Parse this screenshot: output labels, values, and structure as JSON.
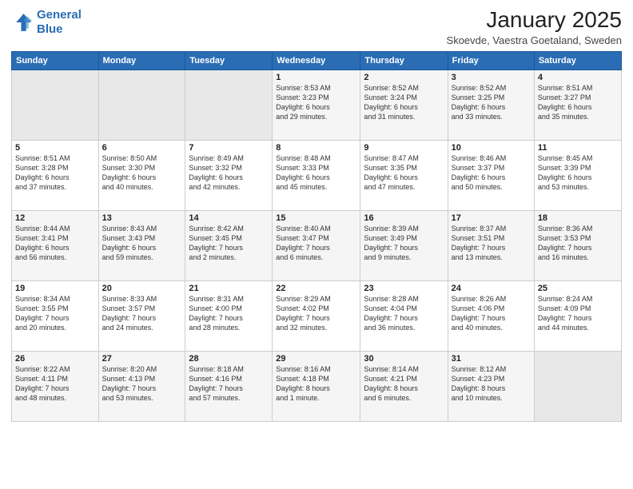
{
  "header": {
    "logo_line1": "General",
    "logo_line2": "Blue",
    "month": "January 2025",
    "location": "Skoevde, Vaestra Goetaland, Sweden"
  },
  "weekdays": [
    "Sunday",
    "Monday",
    "Tuesday",
    "Wednesday",
    "Thursday",
    "Friday",
    "Saturday"
  ],
  "weeks": [
    [
      {
        "day": "",
        "info": ""
      },
      {
        "day": "",
        "info": ""
      },
      {
        "day": "",
        "info": ""
      },
      {
        "day": "1",
        "info": "Sunrise: 8:53 AM\nSunset: 3:23 PM\nDaylight: 6 hours\nand 29 minutes."
      },
      {
        "day": "2",
        "info": "Sunrise: 8:52 AM\nSunset: 3:24 PM\nDaylight: 6 hours\nand 31 minutes."
      },
      {
        "day": "3",
        "info": "Sunrise: 8:52 AM\nSunset: 3:25 PM\nDaylight: 6 hours\nand 33 minutes."
      },
      {
        "day": "4",
        "info": "Sunrise: 8:51 AM\nSunset: 3:27 PM\nDaylight: 6 hours\nand 35 minutes."
      }
    ],
    [
      {
        "day": "5",
        "info": "Sunrise: 8:51 AM\nSunset: 3:28 PM\nDaylight: 6 hours\nand 37 minutes."
      },
      {
        "day": "6",
        "info": "Sunrise: 8:50 AM\nSunset: 3:30 PM\nDaylight: 6 hours\nand 40 minutes."
      },
      {
        "day": "7",
        "info": "Sunrise: 8:49 AM\nSunset: 3:32 PM\nDaylight: 6 hours\nand 42 minutes."
      },
      {
        "day": "8",
        "info": "Sunrise: 8:48 AM\nSunset: 3:33 PM\nDaylight: 6 hours\nand 45 minutes."
      },
      {
        "day": "9",
        "info": "Sunrise: 8:47 AM\nSunset: 3:35 PM\nDaylight: 6 hours\nand 47 minutes."
      },
      {
        "day": "10",
        "info": "Sunrise: 8:46 AM\nSunset: 3:37 PM\nDaylight: 6 hours\nand 50 minutes."
      },
      {
        "day": "11",
        "info": "Sunrise: 8:45 AM\nSunset: 3:39 PM\nDaylight: 6 hours\nand 53 minutes."
      }
    ],
    [
      {
        "day": "12",
        "info": "Sunrise: 8:44 AM\nSunset: 3:41 PM\nDaylight: 6 hours\nand 56 minutes."
      },
      {
        "day": "13",
        "info": "Sunrise: 8:43 AM\nSunset: 3:43 PM\nDaylight: 6 hours\nand 59 minutes."
      },
      {
        "day": "14",
        "info": "Sunrise: 8:42 AM\nSunset: 3:45 PM\nDaylight: 7 hours\nand 2 minutes."
      },
      {
        "day": "15",
        "info": "Sunrise: 8:40 AM\nSunset: 3:47 PM\nDaylight: 7 hours\nand 6 minutes."
      },
      {
        "day": "16",
        "info": "Sunrise: 8:39 AM\nSunset: 3:49 PM\nDaylight: 7 hours\nand 9 minutes."
      },
      {
        "day": "17",
        "info": "Sunrise: 8:37 AM\nSunset: 3:51 PM\nDaylight: 7 hours\nand 13 minutes."
      },
      {
        "day": "18",
        "info": "Sunrise: 8:36 AM\nSunset: 3:53 PM\nDaylight: 7 hours\nand 16 minutes."
      }
    ],
    [
      {
        "day": "19",
        "info": "Sunrise: 8:34 AM\nSunset: 3:55 PM\nDaylight: 7 hours\nand 20 minutes."
      },
      {
        "day": "20",
        "info": "Sunrise: 8:33 AM\nSunset: 3:57 PM\nDaylight: 7 hours\nand 24 minutes."
      },
      {
        "day": "21",
        "info": "Sunrise: 8:31 AM\nSunset: 4:00 PM\nDaylight: 7 hours\nand 28 minutes."
      },
      {
        "day": "22",
        "info": "Sunrise: 8:29 AM\nSunset: 4:02 PM\nDaylight: 7 hours\nand 32 minutes."
      },
      {
        "day": "23",
        "info": "Sunrise: 8:28 AM\nSunset: 4:04 PM\nDaylight: 7 hours\nand 36 minutes."
      },
      {
        "day": "24",
        "info": "Sunrise: 8:26 AM\nSunset: 4:06 PM\nDaylight: 7 hours\nand 40 minutes."
      },
      {
        "day": "25",
        "info": "Sunrise: 8:24 AM\nSunset: 4:09 PM\nDaylight: 7 hours\nand 44 minutes."
      }
    ],
    [
      {
        "day": "26",
        "info": "Sunrise: 8:22 AM\nSunset: 4:11 PM\nDaylight: 7 hours\nand 48 minutes."
      },
      {
        "day": "27",
        "info": "Sunrise: 8:20 AM\nSunset: 4:13 PM\nDaylight: 7 hours\nand 53 minutes."
      },
      {
        "day": "28",
        "info": "Sunrise: 8:18 AM\nSunset: 4:16 PM\nDaylight: 7 hours\nand 57 minutes."
      },
      {
        "day": "29",
        "info": "Sunrise: 8:16 AM\nSunset: 4:18 PM\nDaylight: 8 hours\nand 1 minute."
      },
      {
        "day": "30",
        "info": "Sunrise: 8:14 AM\nSunset: 4:21 PM\nDaylight: 8 hours\nand 6 minutes."
      },
      {
        "day": "31",
        "info": "Sunrise: 8:12 AM\nSunset: 4:23 PM\nDaylight: 8 hours\nand 10 minutes."
      },
      {
        "day": "",
        "info": ""
      }
    ]
  ]
}
